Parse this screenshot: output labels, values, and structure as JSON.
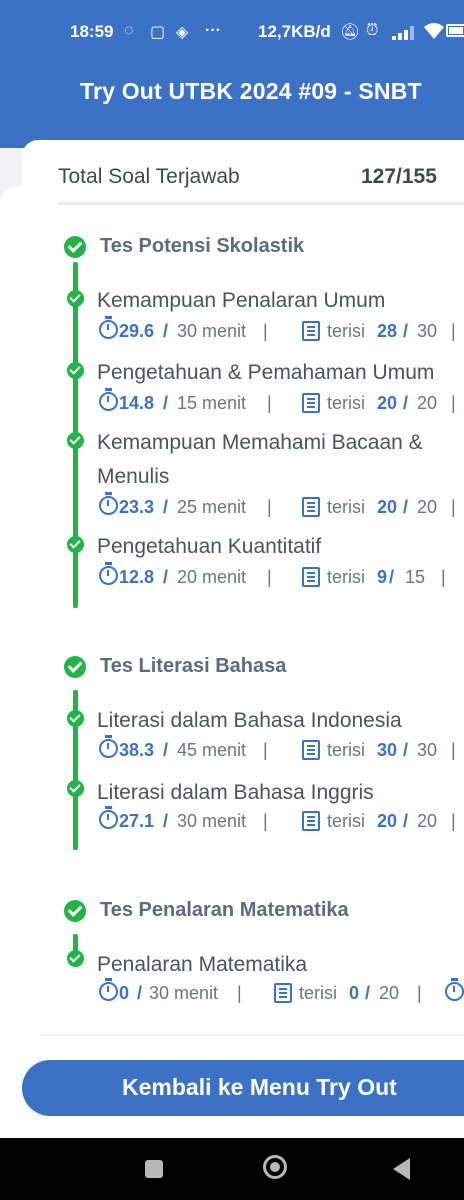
{
  "status_bar": {
    "time": "18:59",
    "icons": [
      "whatsapp-icon",
      "instagram-icon",
      "layers-icon",
      "more-dots-icon"
    ],
    "more": "···",
    "speed": "12,7KB/d",
    "right_icons": [
      "mute-icon",
      "alarm-icon",
      "signal-icon",
      "wifi-icon",
      "battery-icon"
    ]
  },
  "header": {
    "title": "Try Out UTBK 2024 #09 - SNBT"
  },
  "summary": {
    "label": "Total Soal Terjawab",
    "value": "127/155"
  },
  "sections": [
    {
      "title": "Tes Potensi Skolastik",
      "items": [
        {
          "title": "Kemampuan Penalaran Umum",
          "time_used": "29.6",
          "time_total": "30 menit",
          "filled_label": "terisi",
          "filled": "28",
          "total": "30"
        },
        {
          "title": "Pengetahuan & Pemahaman Umum",
          "time_used": "14.8",
          "time_total": "15 menit",
          "filled_label": "terisi",
          "filled": "20",
          "total": "20"
        },
        {
          "title_line1": "Kemampuan Memahami Bacaan &",
          "title_line2": "Menulis",
          "time_used": "23.3",
          "time_total": "25 menit",
          "filled_label": "terisi",
          "filled": "20",
          "total": "20"
        },
        {
          "title": "Pengetahuan Kuantitatif",
          "time_used": "12.8",
          "time_total": "20 menit",
          "filled_label": "terisi",
          "filled": "9",
          "total": "15"
        }
      ]
    },
    {
      "title": "Tes Literasi Bahasa",
      "items": [
        {
          "title": "Literasi dalam Bahasa Indonesia",
          "time_used": "38.3",
          "time_total": "45 menit",
          "filled_label": "terisi",
          "filled": "30",
          "total": "30"
        },
        {
          "title": "Literasi dalam Bahasa Inggris",
          "time_used": "27.1",
          "time_total": "30 menit",
          "filled_label": "terisi",
          "filled": "20",
          "total": "20"
        }
      ]
    },
    {
      "title": "Tes Penalaran Matematika",
      "items": [
        {
          "title": "Penalaran Matematika",
          "time_used": "0",
          "time_total": "30 menit",
          "filled_label": "terisi",
          "filled": "0",
          "total": "20"
        }
      ]
    }
  ],
  "separators": {
    "slash": "/",
    "pipe": "|"
  },
  "button": {
    "label": "Kembali ke Menu Try Out"
  },
  "colors": {
    "primary": "#3b72c6",
    "success": "#22b449",
    "text": "#4a5566"
  }
}
